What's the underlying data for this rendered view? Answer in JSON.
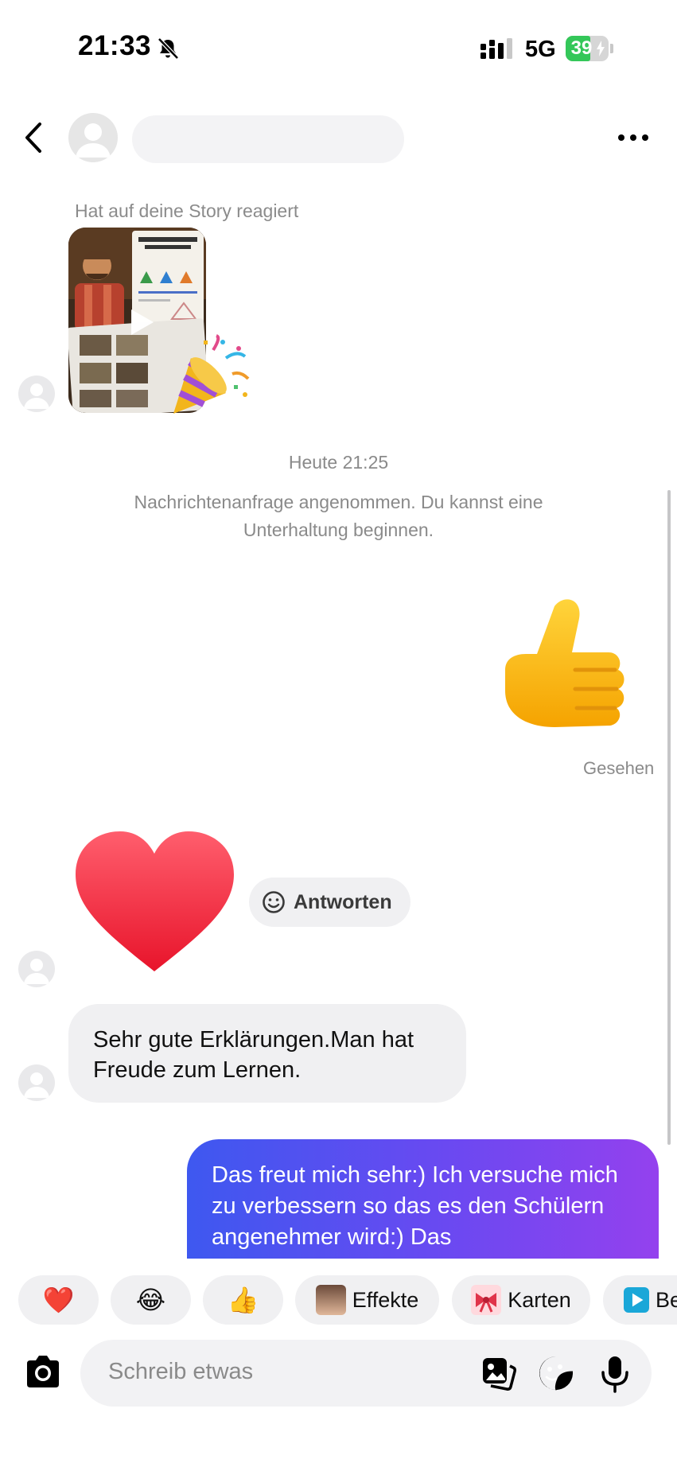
{
  "status_bar": {
    "time": "21:33",
    "network": "5G",
    "battery": "39"
  },
  "header": {
    "back_icon": "chevron-left-icon",
    "more_icon": "more-horizontal-icon"
  },
  "conversation": {
    "story_caption": "Hat auf deine Story reagiert",
    "day_separator": "Heute 21:25",
    "system_message": "Nachrichtenanfrage angenommen. Du kannst eine Unterhaltung beginnen.",
    "sent_emoji": "thumbs-up",
    "seen_label": "Gesehen",
    "received_emoji": "red-heart",
    "reply_label": "Antworten",
    "incoming_text": "Sehr gute Erklärungen.Man hat Freude zum Lernen.",
    "outgoing_text": "Das freut mich sehr:) Ich versuche mich zu verbessern so das es den Schülern angenehmer wird:) Das"
  },
  "quick_replies": [
    {
      "emoji": "❤️"
    },
    {
      "emoji": "😂"
    },
    {
      "emoji": "👍"
    },
    {
      "label": "Effekte"
    },
    {
      "label": "Karten"
    },
    {
      "label": "Be"
    }
  ],
  "composer": {
    "placeholder": "Schreib etwas"
  },
  "colors": {
    "outgoing_gradient_start": "#3e58f0",
    "outgoing_gradient_end": "#9441ee",
    "battery_green": "#34c759",
    "bubble_gray": "#f0f0f2"
  }
}
